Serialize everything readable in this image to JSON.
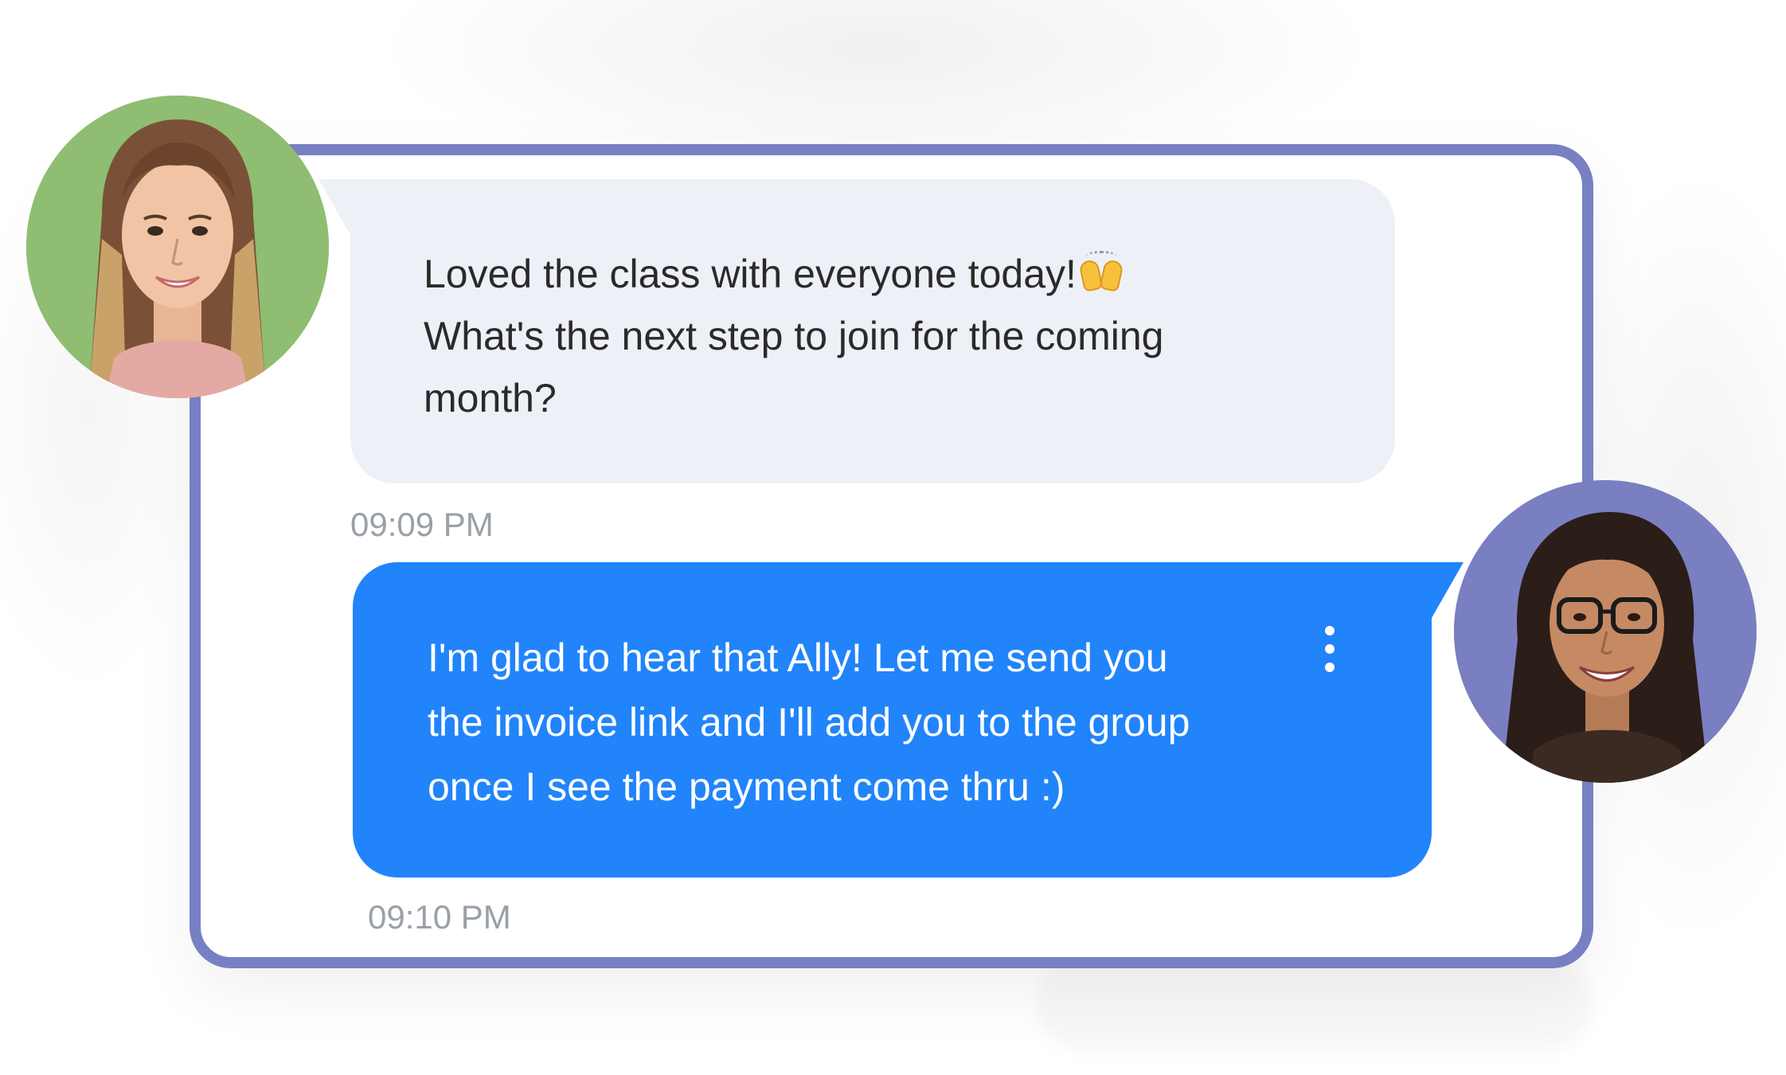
{
  "conversation": {
    "incoming_message": {
      "lines": [
        "Loved the class with everyone today!",
        "What's the next step to join for the coming",
        "month?"
      ],
      "emoji": "raising-hands-emoji",
      "timestamp": "09:09 PM"
    },
    "outgoing_message": {
      "lines": [
        "I'm glad to hear that Ally! Let me send you",
        "the invoice link and I'll add you to the group",
        "once I see the payment come thru :)"
      ],
      "timestamp": "09:10 PM",
      "menu_icon": "more-vertical-icon"
    }
  },
  "colors": {
    "card_border": "#7780c2",
    "incoming_bubble": "#eef0f7",
    "outgoing_bubble": "#2184fb",
    "timestamp_text": "#9aa0a8",
    "sender_avatar_bg": "#8fbd72",
    "recipient_avatar_bg": "#7a7fc1"
  }
}
